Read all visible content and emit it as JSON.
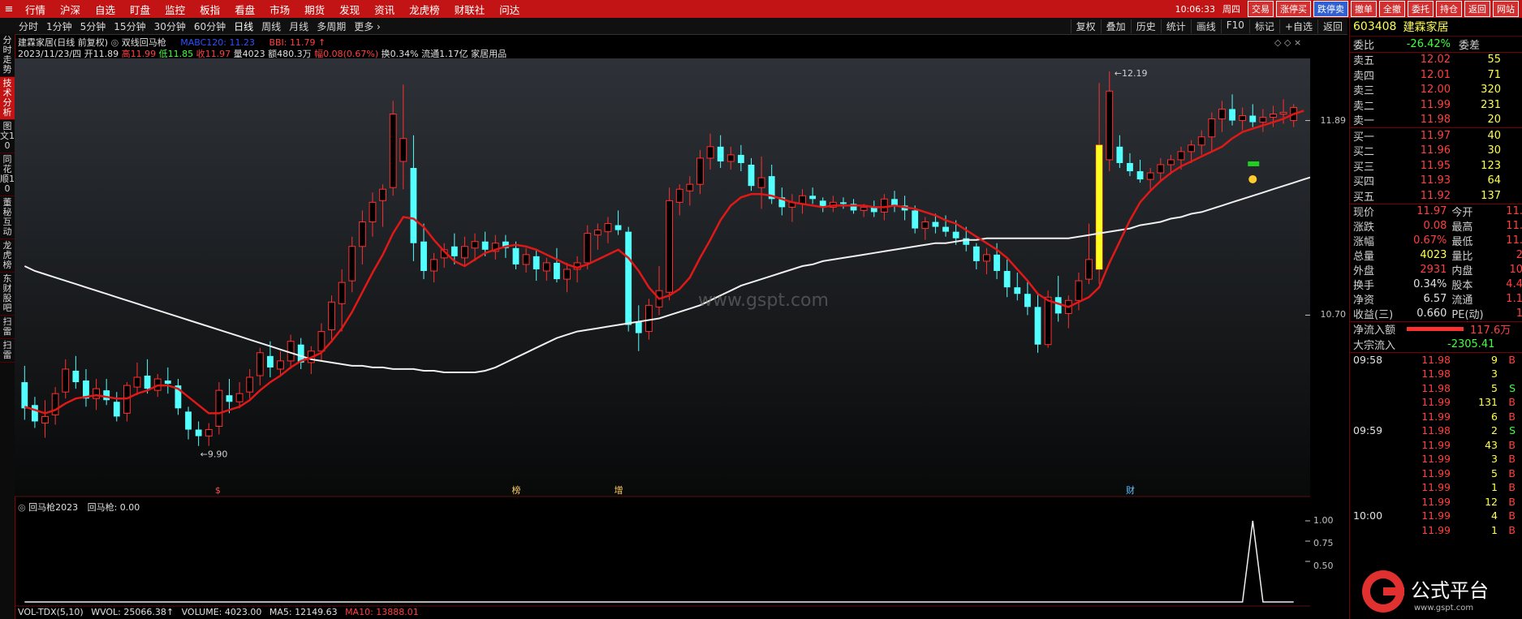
{
  "menubar": {
    "items": [
      "行情",
      "沪深",
      "自选",
      "盯盘",
      "监控",
      "板指",
      "看盘",
      "市场",
      "期货",
      "发现",
      "资讯",
      "龙虎榜",
      "财联社",
      "问达"
    ],
    "time": "10:06:33",
    "weekday": "周四",
    "buttons": [
      "交易",
      "涨停买",
      "跌停卖",
      "撤单",
      "全撤",
      "委托",
      "持仓",
      "返回",
      "网站"
    ]
  },
  "toolbar": {
    "periods": [
      "分时",
      "1分钟",
      "5分钟",
      "15分钟",
      "30分钟",
      "60分钟",
      "日线",
      "周线",
      "月线",
      "多周期",
      "更多"
    ],
    "tools": [
      "复权",
      "叠加",
      "历史",
      "统计",
      "画线",
      "F10",
      "标记",
      "+自选",
      "返回"
    ]
  },
  "leftbar": {
    "tabs": [
      "分时走势",
      "技术分析",
      "图文10",
      "同花顺10",
      "董秘互动",
      "龙虎榜",
      "东财股吧",
      "扫雷",
      "扫雷"
    ]
  },
  "chart_header": {
    "line1_name": "建霖家居(日线 前复权)",
    "line1_formula": "双线回马枪",
    "line1_mabc": "MABC120: 11.23",
    "line1_bbi": "BBI: 11.79",
    "line2_date": "2023/11/23/四",
    "line2_open": "开11.89",
    "line2_high": "高11.99",
    "line2_low": "低11.85",
    "line2_close": "收11.97",
    "line2_vol": "量4023",
    "line2_amount": "额480.3万",
    "line2_change": "幅0.08(0.67%)",
    "line2_turnover": "换0.34%",
    "line2_float": "流通1.17亿",
    "line2_sector": "家居用品"
  },
  "chart_data": {
    "type": "candlestick",
    "ohlc": [
      [
        10.29,
        10.39,
        10.06,
        10.13
      ],
      [
        10.15,
        10.2,
        10.01,
        10.05
      ],
      [
        10.04,
        10.18,
        9.95,
        10.08
      ],
      [
        10.09,
        10.26,
        10.03,
        10.22
      ],
      [
        10.23,
        10.43,
        10.19,
        10.37
      ],
      [
        10.36,
        10.45,
        10.25,
        10.29
      ],
      [
        10.3,
        10.37,
        10.14,
        10.19
      ],
      [
        10.19,
        10.31,
        10.12,
        10.25
      ],
      [
        10.24,
        10.31,
        10.15,
        10.18
      ],
      [
        10.17,
        10.23,
        10.05,
        10.08
      ],
      [
        10.1,
        10.29,
        10.05,
        10.27
      ],
      [
        10.26,
        10.41,
        10.21,
        10.32
      ],
      [
        10.33,
        10.43,
        10.22,
        10.25
      ],
      [
        10.24,
        10.34,
        10.2,
        10.31
      ],
      [
        10.3,
        10.38,
        10.22,
        10.28
      ],
      [
        10.27,
        10.31,
        10.09,
        10.13
      ],
      [
        10.11,
        10.14,
        9.94,
        10.0
      ],
      [
        10.0,
        10.05,
        9.9,
        9.96
      ],
      [
        9.96,
        10.04,
        9.9,
        10.0
      ],
      [
        10.02,
        10.29,
        9.97,
        10.24
      ],
      [
        10.21,
        10.31,
        10.1,
        10.17
      ],
      [
        10.17,
        10.29,
        10.13,
        10.22
      ],
      [
        10.23,
        10.37,
        10.19,
        10.32
      ],
      [
        10.33,
        10.5,
        10.27,
        10.47
      ],
      [
        10.45,
        10.54,
        10.32,
        10.38
      ],
      [
        10.37,
        10.48,
        10.33,
        10.42
      ],
      [
        10.42,
        10.58,
        10.37,
        10.54
      ],
      [
        10.52,
        10.56,
        10.37,
        10.41
      ],
      [
        10.41,
        10.51,
        10.34,
        10.48
      ],
      [
        10.48,
        10.65,
        10.42,
        10.6
      ],
      [
        10.61,
        10.82,
        10.55,
        10.78
      ],
      [
        10.77,
        10.98,
        10.6,
        10.9
      ],
      [
        10.91,
        11.18,
        10.84,
        11.12
      ],
      [
        11.12,
        11.34,
        11.01,
        11.27
      ],
      [
        11.27,
        11.45,
        11.18,
        11.39
      ],
      [
        11.4,
        11.5,
        11.24,
        11.47
      ],
      [
        11.48,
        12.01,
        11.43,
        11.93
      ],
      [
        11.64,
        12.11,
        11.47,
        11.78
      ],
      [
        11.6,
        11.8,
        11.03,
        11.14
      ],
      [
        11.15,
        11.26,
        10.92,
        10.97
      ],
      [
        10.97,
        11.08,
        10.9,
        11.04
      ],
      [
        11.05,
        11.14,
        10.99,
        11.1
      ],
      [
        11.12,
        11.2,
        11.01,
        11.06
      ],
      [
        11.05,
        11.18,
        11.0,
        11.12
      ],
      [
        11.11,
        11.2,
        11.03,
        11.15
      ],
      [
        11.15,
        11.21,
        11.06,
        11.1
      ],
      [
        11.09,
        11.19,
        11.04,
        11.14
      ],
      [
        11.15,
        11.19,
        11.05,
        11.11
      ],
      [
        11.11,
        11.15,
        10.98,
        11.01
      ],
      [
        11.01,
        11.11,
        10.96,
        11.07
      ],
      [
        11.06,
        11.1,
        10.91,
        10.98
      ],
      [
        10.97,
        11.05,
        10.91,
        11.02
      ],
      [
        11.02,
        11.11,
        10.9,
        10.92
      ],
      [
        10.92,
        11.02,
        10.84,
        10.98
      ],
      [
        10.98,
        11.06,
        10.9,
        11.02
      ],
      [
        11.02,
        11.25,
        10.98,
        11.2
      ],
      [
        11.19,
        11.26,
        11.1,
        11.22
      ],
      [
        11.21,
        11.3,
        11.14,
        11.26
      ],
      [
        11.25,
        11.34,
        11.19,
        11.22
      ],
      [
        11.21,
        11.24,
        10.6,
        10.64
      ],
      [
        10.66,
        10.76,
        10.48,
        10.59
      ],
      [
        10.6,
        10.8,
        10.55,
        10.76
      ],
      [
        10.75,
        11.0,
        10.7,
        10.85
      ],
      [
        10.84,
        11.48,
        10.79,
        11.4
      ],
      [
        11.39,
        11.5,
        11.31,
        11.47
      ],
      [
        11.46,
        11.55,
        11.37,
        11.5
      ],
      [
        11.5,
        11.71,
        11.44,
        11.66
      ],
      [
        11.66,
        11.81,
        11.59,
        11.73
      ],
      [
        11.73,
        11.8,
        11.6,
        11.64
      ],
      [
        11.64,
        11.73,
        11.59,
        11.68
      ],
      [
        11.68,
        11.74,
        11.58,
        11.63
      ],
      [
        11.62,
        11.66,
        11.46,
        11.49
      ],
      [
        11.48,
        11.67,
        11.35,
        11.54
      ],
      [
        11.55,
        11.62,
        11.38,
        11.41
      ],
      [
        11.42,
        11.48,
        11.31,
        11.36
      ],
      [
        11.36,
        11.44,
        11.27,
        11.39
      ],
      [
        11.38,
        11.47,
        11.32,
        11.43
      ],
      [
        11.43,
        11.48,
        11.38,
        11.41
      ],
      [
        11.4,
        11.42,
        11.33,
        11.36
      ],
      [
        11.36,
        11.43,
        11.33,
        11.39
      ],
      [
        11.39,
        11.42,
        11.35,
        11.38
      ],
      [
        11.38,
        11.41,
        11.32,
        11.34
      ],
      [
        11.34,
        11.38,
        11.3,
        11.36
      ],
      [
        11.36,
        11.4,
        11.3,
        11.33
      ],
      [
        11.33,
        11.44,
        11.28,
        11.41
      ],
      [
        11.41,
        11.46,
        11.33,
        11.37
      ],
      [
        11.37,
        11.43,
        11.28,
        11.34
      ],
      [
        11.34,
        11.37,
        11.2,
        11.23
      ],
      [
        11.23,
        11.3,
        11.16,
        11.27
      ],
      [
        11.27,
        11.32,
        11.2,
        11.24
      ],
      [
        11.24,
        11.31,
        11.18,
        11.21
      ],
      [
        11.21,
        11.28,
        11.13,
        11.17
      ],
      [
        11.17,
        11.24,
        11.09,
        11.13
      ],
      [
        11.12,
        11.14,
        10.98,
        11.03
      ],
      [
        11.03,
        11.11,
        10.95,
        11.07
      ],
      [
        11.07,
        11.14,
        10.92,
        10.97
      ],
      [
        10.97,
        11.04,
        10.81,
        10.87
      ],
      [
        10.87,
        10.96,
        10.79,
        10.83
      ],
      [
        10.83,
        10.91,
        10.7,
        10.75
      ],
      [
        10.75,
        10.83,
        10.47,
        10.52
      ],
      [
        10.52,
        10.85,
        10.5,
        10.81
      ],
      [
        10.81,
        10.94,
        10.66,
        10.71
      ],
      [
        10.71,
        10.82,
        10.62,
        10.79
      ],
      [
        10.79,
        10.96,
        10.73,
        10.91
      ],
      [
        10.92,
        11.26,
        10.89,
        11.04
      ],
      [
        10.98,
        12.12,
        10.89,
        11.74
      ],
      [
        11.65,
        12.19,
        11.58,
        12.07
      ],
      [
        11.73,
        11.8,
        11.6,
        11.63
      ],
      [
        11.63,
        11.69,
        11.55,
        11.58
      ],
      [
        11.58,
        11.65,
        11.51,
        11.53
      ],
      [
        11.53,
        11.6,
        11.47,
        11.57
      ],
      [
        11.57,
        11.66,
        11.52,
        11.62
      ],
      [
        11.62,
        11.68,
        11.56,
        11.65
      ],
      [
        11.65,
        11.73,
        11.59,
        11.7
      ],
      [
        11.7,
        11.77,
        11.63,
        11.74
      ],
      [
        11.74,
        11.83,
        11.68,
        11.79
      ],
      [
        11.79,
        11.94,
        11.7,
        11.9
      ],
      [
        11.9,
        12.01,
        11.82,
        11.96
      ],
      [
        11.96,
        12.05,
        11.86,
        11.89
      ],
      [
        11.89,
        11.97,
        11.83,
        11.92
      ],
      [
        11.92,
        11.99,
        11.85,
        11.88
      ],
      [
        11.88,
        11.96,
        11.82,
        11.91
      ],
      [
        11.91,
        11.98,
        11.85,
        11.93
      ],
      [
        11.93,
        12.02,
        11.87,
        11.94
      ],
      [
        11.89,
        11.99,
        11.85,
        11.97
      ]
    ],
    "ma_red": [
      10.14,
      10.12,
      10.1,
      10.12,
      10.16,
      10.19,
      10.2,
      10.21,
      10.2,
      10.19,
      10.19,
      10.22,
      10.24,
      10.27,
      10.27,
      10.25,
      10.2,
      10.15,
      10.1,
      10.1,
      10.12,
      10.14,
      10.18,
      10.24,
      10.29,
      10.33,
      10.38,
      10.42,
      10.44,
      10.47,
      10.54,
      10.62,
      10.72,
      10.84,
      10.96,
      11.07,
      11.2,
      11.3,
      11.29,
      11.24,
      11.16,
      11.09,
      11.03,
      11.0,
      11.04,
      11.08,
      11.1,
      11.12,
      11.13,
      11.12,
      11.1,
      11.07,
      11.04,
      11.01,
      10.99,
      11.01,
      11.04,
      11.07,
      11.1,
      11.05,
      10.97,
      10.87,
      10.8,
      10.82,
      10.86,
      10.93,
      11.05,
      11.16,
      11.28,
      11.37,
      11.42,
      11.44,
      11.44,
      11.43,
      11.41,
      11.39,
      11.38,
      11.37,
      11.36,
      11.37,
      11.37,
      11.37,
      11.37,
      11.36,
      11.36,
      11.37,
      11.36,
      11.35,
      11.33,
      11.31,
      11.28,
      11.26,
      11.22,
      11.18,
      11.14,
      11.1,
      11.05,
      10.98,
      10.91,
      10.83,
      10.79,
      10.77,
      10.75,
      10.78,
      10.81,
      10.87,
      11.02,
      11.15,
      11.28,
      11.39,
      11.46,
      11.52,
      11.57,
      11.61,
      11.64,
      11.67,
      11.7,
      11.73,
      11.78,
      11.82,
      11.84,
      11.86,
      11.88,
      11.9,
      11.93,
      11.95
    ],
    "ma_white": [
      11.0,
      10.97,
      10.95,
      10.93,
      10.91,
      10.89,
      10.87,
      10.85,
      10.83,
      10.81,
      10.79,
      10.77,
      10.75,
      10.73,
      10.71,
      10.69,
      10.67,
      10.65,
      10.63,
      10.61,
      10.59,
      10.57,
      10.55,
      10.53,
      10.51,
      10.49,
      10.47,
      10.45,
      10.43,
      10.42,
      10.41,
      10.4,
      10.39,
      10.39,
      10.38,
      10.38,
      10.37,
      10.37,
      10.37,
      10.36,
      10.36,
      10.35,
      10.35,
      10.35,
      10.35,
      10.36,
      10.38,
      10.41,
      10.44,
      10.47,
      10.5,
      10.53,
      10.56,
      10.58,
      10.6,
      10.61,
      10.62,
      10.63,
      10.64,
      10.65,
      10.66,
      10.67,
      10.68,
      10.7,
      10.72,
      10.74,
      10.76,
      10.79,
      10.82,
      10.85,
      10.88,
      10.9,
      10.92,
      10.94,
      10.96,
      10.98,
      11.0,
      11.01,
      11.03,
      11.04,
      11.05,
      11.06,
      11.07,
      11.08,
      11.09,
      11.1,
      11.11,
      11.12,
      11.13,
      11.14,
      11.14,
      11.15,
      11.16,
      11.16,
      11.17,
      11.17,
      11.17,
      11.17,
      11.17,
      11.17,
      11.17,
      11.17,
      11.17,
      11.18,
      11.19,
      11.2,
      11.21,
      11.22,
      11.23,
      11.25,
      11.26,
      11.27,
      11.29,
      11.3,
      11.32,
      11.33,
      11.35,
      11.37,
      11.39,
      11.41,
      11.43,
      11.45,
      11.47,
      11.49,
      11.51,
      11.53,
      11.55
    ],
    "ylim": [
      9.7,
      12.25
    ],
    "right_ticks": [
      "11.89",
      "10.70"
    ],
    "annotations": {
      "high_label": "12.19",
      "low_label": "9.90"
    },
    "markers": [
      {
        "index": 19,
        "label": "$"
      },
      {
        "index": 48,
        "label": "榜"
      },
      {
        "index": 58,
        "label": "增"
      },
      {
        "index": 108,
        "label": "财"
      }
    ],
    "sub_indicator": {
      "name": "回马枪2023",
      "value_label": "回马枪: 0.00",
      "ticks": [
        "1.00",
        "0.75",
        "0.50"
      ],
      "spike_index": 120,
      "ylim": [
        0,
        1.2
      ]
    }
  },
  "volume_header": {
    "name": "VOL-TDX(5,10)",
    "wvol": "WVOL: 25066.38↑",
    "volume": "VOLUME: 4023.00",
    "ma5": "MA5: 12149.63",
    "ma10": "MA10: 13888.01"
  },
  "quote": {
    "code": "603408",
    "name": "建霖家居",
    "weibi_label": "委比",
    "weibi_value": "-26.42%",
    "weicha_label": "委差",
    "asks": [
      {
        "label": "卖五",
        "price": "12.02",
        "vol": "55"
      },
      {
        "label": "卖四",
        "price": "12.01",
        "vol": "71"
      },
      {
        "label": "卖三",
        "price": "12.00",
        "vol": "320"
      },
      {
        "label": "卖二",
        "price": "11.99",
        "vol": "231"
      },
      {
        "label": "卖一",
        "price": "11.98",
        "vol": "20"
      }
    ],
    "bids": [
      {
        "label": "买一",
        "price": "11.97",
        "vol": "40"
      },
      {
        "label": "买二",
        "price": "11.96",
        "vol": "30"
      },
      {
        "label": "买三",
        "price": "11.95",
        "vol": "123"
      },
      {
        "label": "买四",
        "price": "11.93",
        "vol": "64"
      },
      {
        "label": "买五",
        "price": "11.92",
        "vol": "137"
      }
    ],
    "stats": [
      {
        "a": "现价",
        "b": "11.97",
        "bc": "red",
        "c": "今开",
        "d": "11."
      },
      {
        "a": "涨跌",
        "b": "0.08",
        "bc": "red",
        "c": "最高",
        "d": "11."
      },
      {
        "a": "涨幅",
        "b": "0.67%",
        "bc": "red",
        "c": "最低",
        "d": "11."
      },
      {
        "a": "总量",
        "b": "4023",
        "bc": "yellow",
        "c": "量比",
        "d": "2"
      },
      {
        "a": "外盘",
        "b": "2931",
        "bc": "red",
        "c": "内盘",
        "d": "10"
      },
      {
        "a": "换手",
        "b": "0.34%",
        "bc": "white",
        "c": "股本",
        "d": "4.4"
      },
      {
        "a": "净资",
        "b": "6.57",
        "bc": "white",
        "c": "流通",
        "d": "1.1"
      },
      {
        "a": "收益(三)",
        "b": "0.660",
        "bc": "white",
        "c": "PE(动)",
        "d": "1"
      }
    ],
    "netflow_label": "净流入额",
    "netflow_value": "117.6万",
    "block_label": "大宗流入",
    "block_value": "-2305.41",
    "ticks": [
      {
        "t": "09:58",
        "p": "11.98",
        "v": "9",
        "s": "B"
      },
      {
        "t": "",
        "p": "11.98",
        "v": "3",
        "s": ""
      },
      {
        "t": "",
        "p": "11.98",
        "v": "5",
        "s": "S"
      },
      {
        "t": "",
        "p": "11.99",
        "v": "131",
        "s": "B"
      },
      {
        "t": "",
        "p": "11.99",
        "v": "6",
        "s": "B"
      },
      {
        "t": "09:59",
        "p": "11.98",
        "v": "2",
        "s": "S"
      },
      {
        "t": "",
        "p": "11.99",
        "v": "43",
        "s": "B"
      },
      {
        "t": "",
        "p": "11.99",
        "v": "3",
        "s": "B"
      },
      {
        "t": "",
        "p": "11.99",
        "v": "5",
        "s": "B"
      },
      {
        "t": "",
        "p": "11.99",
        "v": "1",
        "s": "B"
      },
      {
        "t": "",
        "p": "11.99",
        "v": "12",
        "s": "B"
      },
      {
        "t": "10:00",
        "p": "11.99",
        "v": "4",
        "s": "B"
      },
      {
        "t": "",
        "p": "11.99",
        "v": "1",
        "s": "B"
      }
    ]
  },
  "watermark": "www.gspt.com",
  "logo": {
    "text": "公式平台",
    "url": "www.gspt.com"
  },
  "colors": {
    "up": "#ff3030",
    "down": "#54ffff",
    "ma_red": "#e01818",
    "ma_white": "#f0f0f0",
    "menubar": "#c21414"
  }
}
